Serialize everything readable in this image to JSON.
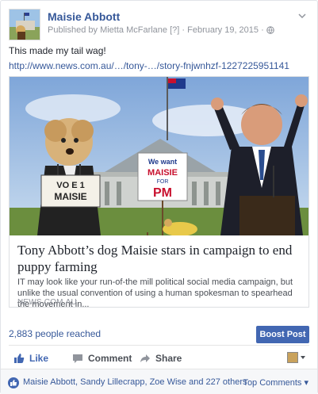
{
  "post": {
    "author": "Maisie Abbott",
    "published_by_prefix": "Published by",
    "publisher": "Mietta McFarlane",
    "publisher_badge": "[?]",
    "separator": "·",
    "date": "February 19, 2015",
    "privacy_separator": "·",
    "text": "This made my tail wag!",
    "link": "http://www.news.com.au/…/tony-…/story-fnjwnhzf-1227225951141"
  },
  "card": {
    "sign_left_line1": "VO E 1",
    "sign_left_line2": "MAISIE",
    "sign_right_line1": "We want",
    "sign_right_line2": "MAISIE",
    "sign_right_line3": "FOR",
    "sign_right_line4": "PM",
    "title": "Tony Abbott’s dog Maisie stars in campaign to end puppy farming",
    "description": "IT may look like your run-of-the mill political social media campaign, but unlike the usual convention of using a human spokesman to spearhead the movement in...",
    "source": "NEWS.COM.AU"
  },
  "stats": {
    "reach": "2,883 people reached",
    "boost_label": "Boost Post"
  },
  "actions": {
    "like": "Like",
    "comment": "Comment",
    "share": "Share"
  },
  "reactions": {
    "names": "Maisie Abbott, Sandy Lillecrapp, Zoe Wise and 227 others",
    "top_comments": "Top Comments ▾"
  },
  "colors": {
    "link_blue": "#365899",
    "button_blue": "#4267b2",
    "muted_text": "#90949c"
  }
}
